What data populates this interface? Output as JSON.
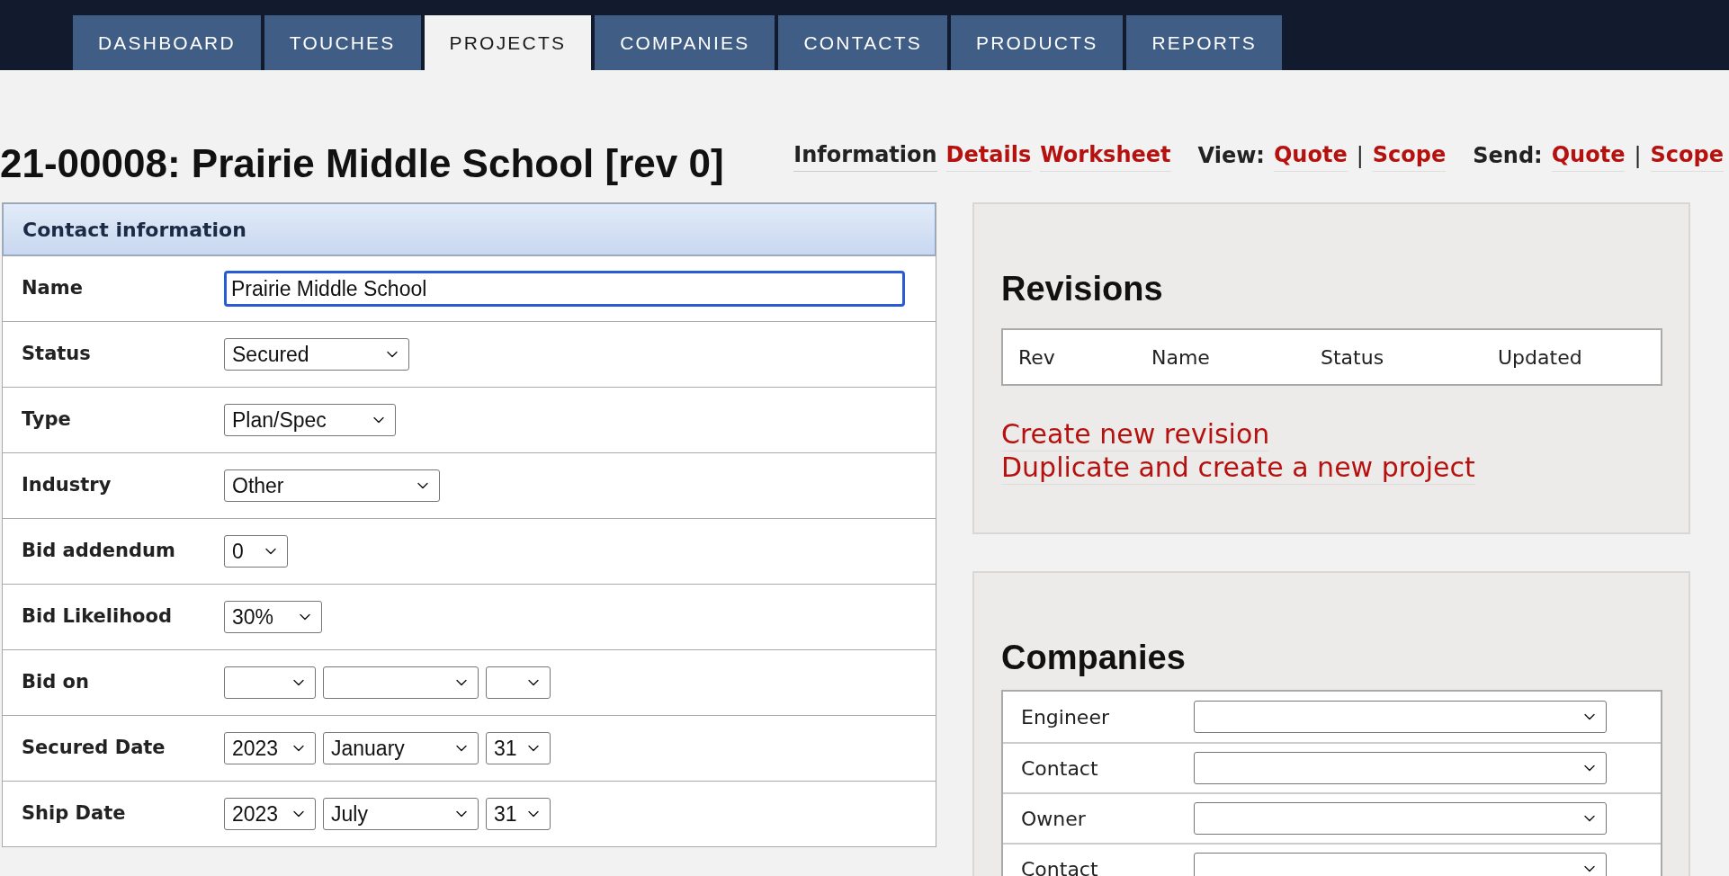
{
  "nav": {
    "tabs": [
      {
        "label": "DASHBOARD",
        "selected": false
      },
      {
        "label": "TOUCHES",
        "selected": false
      },
      {
        "label": "PROJECTS",
        "selected": true
      },
      {
        "label": "COMPANIES",
        "selected": false
      },
      {
        "label": "CONTACTS",
        "selected": false
      },
      {
        "label": "PRODUCTS",
        "selected": false
      },
      {
        "label": "REPORTS",
        "selected": false
      }
    ]
  },
  "page_title": "21-00008: Prairie Middle School [rev 0]",
  "subnav": [
    {
      "kind": "current",
      "text": "Information"
    },
    {
      "kind": "link",
      "text": "Details"
    },
    {
      "kind": "link",
      "text": "Worksheet"
    },
    {
      "kind": "label",
      "text": "View:"
    },
    {
      "kind": "link",
      "text": "Quote"
    },
    {
      "kind": "separator",
      "text": "|"
    },
    {
      "kind": "link",
      "text": "Scope"
    },
    {
      "kind": "label",
      "text": "Send:"
    },
    {
      "kind": "link",
      "text": "Quote"
    },
    {
      "kind": "separator",
      "text": "|"
    },
    {
      "kind": "link",
      "text": "Scope"
    }
  ],
  "contact_form": {
    "title": "Contact information",
    "fields": [
      {
        "label": "Name",
        "kind": "text",
        "value": "Prairie Middle School",
        "focused": true
      },
      {
        "label": "Status",
        "kind": "select",
        "value": "Secured"
      },
      {
        "label": "Type",
        "kind": "select",
        "value": "Plan/Spec"
      },
      {
        "label": "Industry",
        "kind": "select",
        "value": "Other"
      },
      {
        "label": "Bid addendum",
        "kind": "select",
        "value": "0"
      },
      {
        "label": "Bid Likelihood",
        "kind": "select",
        "value": "30%"
      },
      {
        "label": "Bid on",
        "kind": "date"
      },
      {
        "label": "Secured Date",
        "kind": "date",
        "year": "2023",
        "month": "January",
        "day": "31"
      },
      {
        "label": "Ship Date",
        "kind": "date",
        "year": "2023",
        "month": "July",
        "day": "31"
      }
    ]
  },
  "revisions": {
    "title": "Revisions",
    "columns": [
      "Rev",
      "Name",
      "Status",
      "Updated"
    ],
    "actions": [
      "Create new revision",
      "Duplicate and create a new project"
    ]
  },
  "companies": {
    "title": "Companies",
    "rows": [
      {
        "label": "Engineer"
      },
      {
        "label": "Contact"
      },
      {
        "label": "Owner"
      },
      {
        "label": "Contact"
      }
    ]
  }
}
